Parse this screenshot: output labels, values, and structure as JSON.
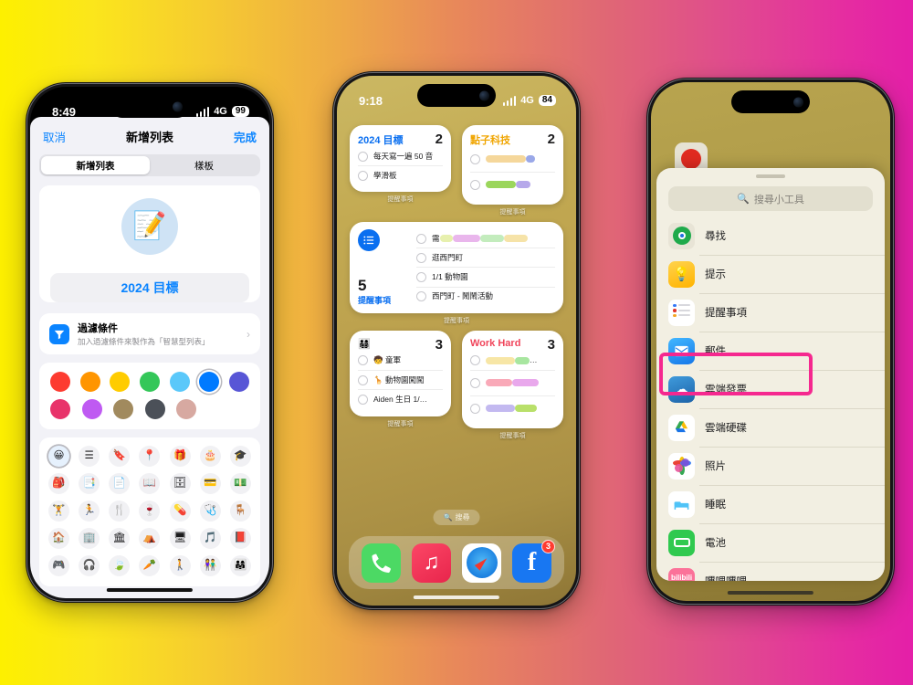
{
  "background": {
    "from": "#fdf000",
    "mid": "#e8885a",
    "to": "#e41fa8"
  },
  "phone1": {
    "statusbar": {
      "time": "8:49",
      "network": "4G",
      "battery": "99"
    },
    "nav": {
      "cancel": "取消",
      "title": "新增列表",
      "done": "完成"
    },
    "segmented": {
      "options": [
        "新增列表",
        "樣板"
      ],
      "selected": "新增列表"
    },
    "list_preview": {
      "emoji": "📝",
      "name": "2024 目標",
      "circle_color": "#cfe3f5",
      "name_color": "#0a84ff"
    },
    "filter": {
      "title": "過濾條件",
      "subtitle": "加入過濾條件來製作為「智慧型列表」",
      "chevron": "›",
      "icon": "filter-icon"
    },
    "colors": {
      "row1": [
        "#fd3b30",
        "#ff9500",
        "#ffcc00",
        "#34c759",
        "#5ac8fa",
        "#007aff",
        "#5856d6"
      ],
      "row2": [
        "#e8336a",
        "#bf5af2",
        "#a18a5e",
        "#4b5058",
        "#d7a9a1"
      ],
      "selected_index": 5
    },
    "glyphs": {
      "row1": [
        "😀",
        "☰",
        "🔖",
        "📍",
        "🎁",
        "🎂",
        "🎓"
      ],
      "row2": [
        "🎒",
        "📑",
        "📄",
        "📖",
        "🗄",
        "💳",
        "💵"
      ],
      "row3": [
        "🏋",
        "🏃",
        "🍴",
        "🍷",
        "💊",
        "🩺",
        "🪑"
      ],
      "row4": [
        "🏠",
        "🏢",
        "🏛",
        "⛺",
        "🖥",
        "🎵",
        "📕"
      ],
      "row5": [
        "🎮",
        "🎧",
        "🍃",
        "🥕",
        "🚶",
        "👫",
        "👨‍👩‍👧"
      ],
      "selected_index": 0
    }
  },
  "phone2": {
    "statusbar": {
      "time": "9:18",
      "network": "4G",
      "battery": "84"
    },
    "widgets": [
      {
        "name": "2024 目標",
        "name_color": "#0a6ff0",
        "count": "2",
        "caption": "提醒事項",
        "items": [
          {
            "text": "每天寫一遍 50 音",
            "redacted": false
          },
          {
            "text": "學滑板",
            "redacted": false
          }
        ]
      },
      {
        "name": "點子科技",
        "name_color": "#f0a500",
        "count": "2",
        "caption": "提醒事項",
        "items": [
          {
            "text": "",
            "redacted": true,
            "bars": [
              {
                "color": "#f5d79b",
                "w": 62
              },
              {
                "color": "#9aa8e8",
                "w": 14
              }
            ]
          },
          {
            "text": "",
            "redacted": true,
            "bars": [
              {
                "color": "#9bd65c",
                "w": 46
              },
              {
                "color": "#b6a8ea",
                "w": 22
              }
            ]
          }
        ]
      },
      {
        "name": "提醒事項",
        "name_color": "#0a6ff0",
        "count": "5",
        "caption": "提醒事項",
        "wide": true,
        "items": [
          {
            "text": "需",
            "redacted": true,
            "bars": [
              {
                "color": "#e7f0ae",
                "w": 14
              },
              {
                "color": "#e9b6ec",
                "w": 30
              },
              {
                "color": "#c3ecbd",
                "w": 26
              },
              {
                "color": "#f6e3a8",
                "w": 26
              }
            ]
          },
          {
            "text": "逛西門町",
            "redacted": false
          },
          {
            "text": "1/1 動物園",
            "redacted": false
          },
          {
            "text": "西門町 - 鬧鬧活動",
            "redacted": false
          }
        ]
      },
      {
        "name": "👨‍👩‍👧‍👦",
        "name_color": "#1c1c1e",
        "count": "3",
        "caption": "提醒事項",
        "items": [
          {
            "text": "🧒 童軍",
            "redacted": false
          },
          {
            "text": "🦒 動物園闖闖",
            "redacted": false
          },
          {
            "text": "Aiden 生日 1/…",
            "redacted": false
          }
        ]
      },
      {
        "name": "Work Hard",
        "name_color": "#f0445a",
        "count": "3",
        "caption": "提醒事項",
        "items": [
          {
            "text": "…",
            "redacted": true,
            "bars": [
              {
                "color": "#f7e6a6",
                "w": 44
              },
              {
                "color": "#a8e6a0",
                "w": 22
              }
            ]
          },
          {
            "text": "",
            "redacted": true,
            "bars": [
              {
                "color": "#f9a9b8",
                "w": 40
              },
              {
                "color": "#e9a8ec",
                "w": 40
              }
            ]
          },
          {
            "text": "",
            "redacted": true,
            "bars": [
              {
                "color": "#c3b9f0",
                "w": 44
              },
              {
                "color": "#b9e06a",
                "w": 34
              }
            ]
          }
        ]
      }
    ],
    "search_pill": {
      "label": "搜尋",
      "icon": "search-icon"
    },
    "dock": [
      {
        "name": "phone-app",
        "glyph": "📞",
        "bg": "#4cd964",
        "badge": ""
      },
      {
        "name": "music-app",
        "glyph": "♫",
        "bg": "#f2385a",
        "badge": ""
      },
      {
        "name": "safari-app",
        "glyph": "🧭",
        "bg": "#ffffff",
        "badge": ""
      },
      {
        "name": "facebook-app",
        "glyph": "f",
        "bg": "#1877f2",
        "badge": "3"
      }
    ]
  },
  "phone3": {
    "search": {
      "placeholder": "搜尋小工具",
      "icon": "search-icon"
    },
    "highlight_color": "#f5288f",
    "items": [
      {
        "label": "尋找",
        "icon": "findmy-icon",
        "bg": "#e8e4d6",
        "glyph": "◉",
        "color": "#1faa4b"
      },
      {
        "label": "提示",
        "icon": "tips-icon",
        "bg": "#ffc83d",
        "glyph": "💡",
        "color": "#ffffff"
      },
      {
        "label": "提醒事項",
        "icon": "reminders-icon",
        "bg": "#ffffff",
        "glyph": "☰",
        "color": "#1c1c1e",
        "highlighted": true
      },
      {
        "label": "郵件",
        "icon": "mail-icon",
        "bg": "#1e8fff",
        "glyph": "✉",
        "color": "#ffffff"
      },
      {
        "label": "雲端發票",
        "icon": "einvoice-icon",
        "bg": "#1f6fb5",
        "glyph": "☁",
        "color": "#ffffff"
      },
      {
        "label": "雲端硬碟",
        "icon": "google-drive-icon",
        "bg": "#ffffff",
        "glyph": "▲",
        "color": "#1aa260"
      },
      {
        "label": "照片",
        "icon": "photos-icon",
        "bg": "#ffffff",
        "glyph": "✿",
        "color": "#ff3b30"
      },
      {
        "label": "睡眠",
        "icon": "sleep-icon",
        "bg": "#ffffff",
        "glyph": "🛏",
        "color": "#4fc3f7"
      },
      {
        "label": "電池",
        "icon": "battery-icon",
        "bg": "#30c94f",
        "glyph": "▭",
        "color": "#ffffff"
      },
      {
        "label": "嗶哩嗶哩",
        "icon": "bilibili-icon",
        "bg": "#fb7299",
        "glyph": "bili",
        "color": "#ffffff"
      }
    ]
  }
}
